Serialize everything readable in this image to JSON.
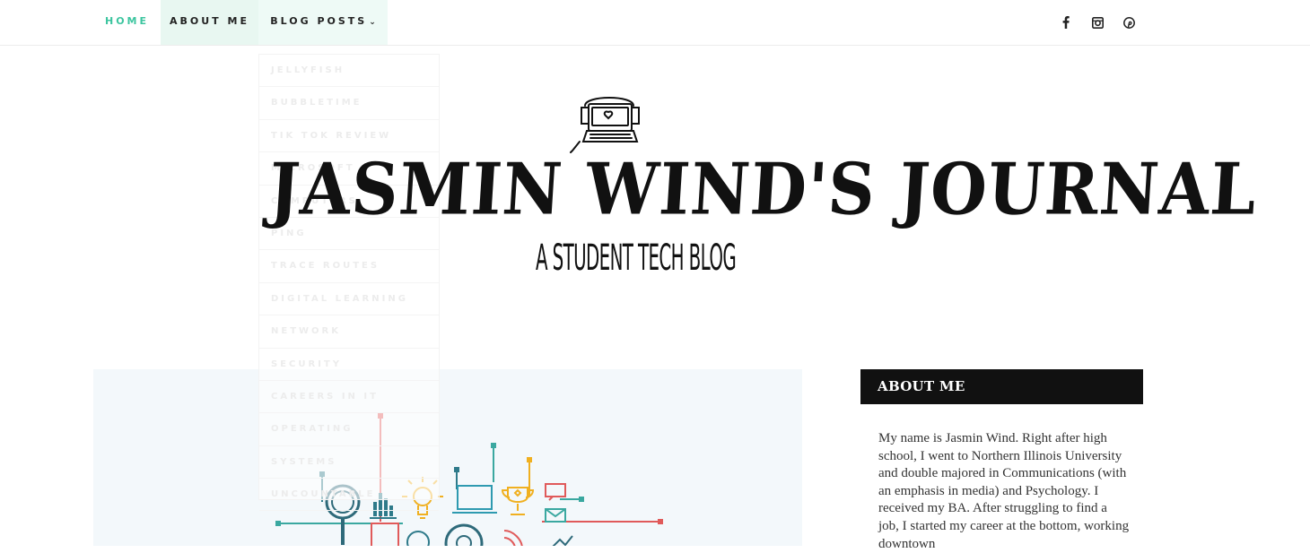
{
  "nav": {
    "items": [
      {
        "label": "HOME"
      },
      {
        "label": "ABOUT ME"
      },
      {
        "label": "BLOG POSTS"
      }
    ],
    "blog_chevron": "⌄"
  },
  "dropdown": {
    "items": [
      "JELLYFISH",
      "BUBBLETIME",
      "TIK TOK REVIEW",
      "MICROSOFT",
      "COMPUTERS",
      "PING",
      "TRACE ROUTES",
      "DIGITAL LEARNING",
      "NETWORK",
      "SECURITY",
      "CAREERS IN IT",
      "OPERATING",
      "SYSTEMS",
      "UNCOUNTABLE"
    ]
  },
  "social": {
    "icons": [
      "facebook-icon",
      "instagram-icon",
      "pinterest-icon"
    ]
  },
  "header": {
    "title": "JASMIN WIND'S JOURNAL",
    "tagline": "A STUDENT TECH BLOG"
  },
  "sidebar": {
    "about_title": "ABOUT ME",
    "about_text": "My name is Jasmin Wind. Right after high school, I went to Northern Illinois University and double majored in Communications (with an emphasis in media) and Psychology. I received my BA. After struggling to find a job, I started my career at the bottom, working downtown"
  },
  "colors": {
    "accent": "#3cc59f",
    "nav_active_bg": "#e8f7f1",
    "widget_bg": "#111111",
    "post_image_bg": "#f3f8fb"
  }
}
